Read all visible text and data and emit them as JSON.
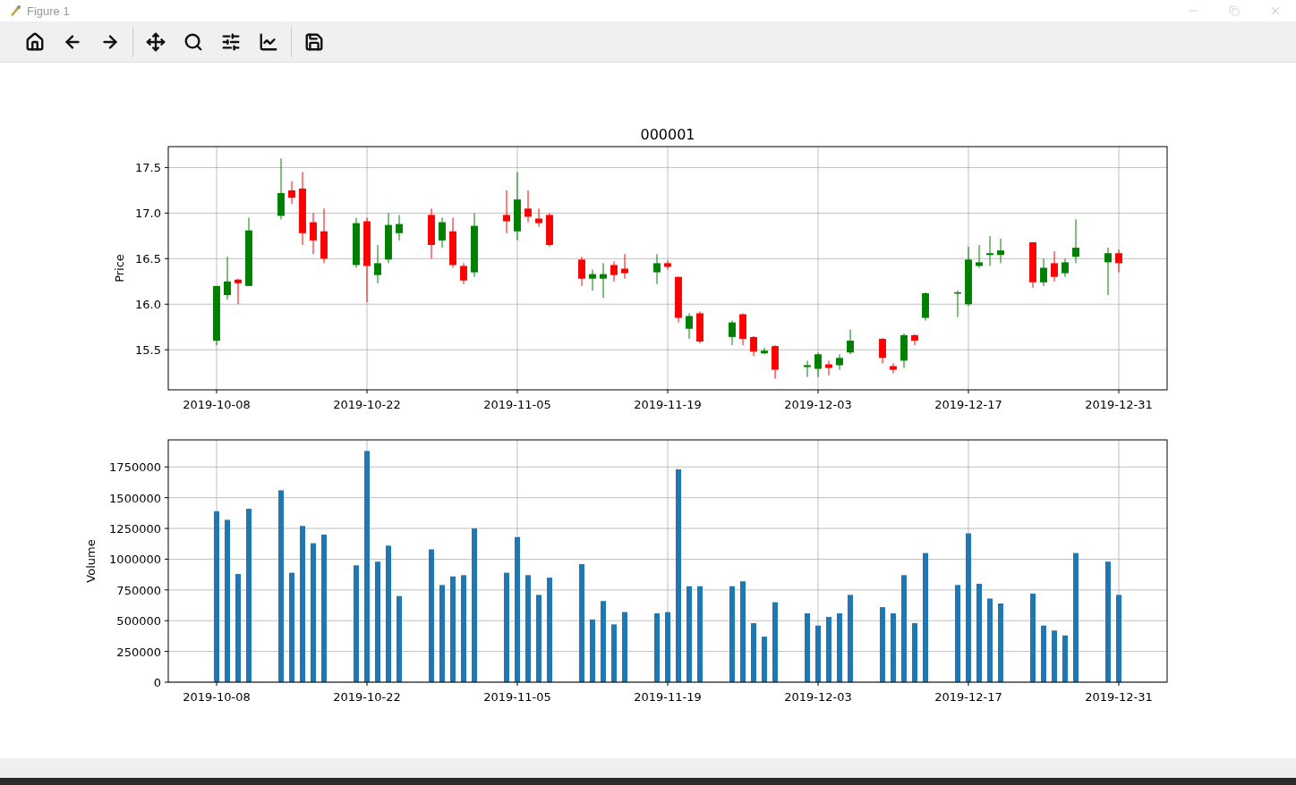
{
  "window": {
    "title": "Figure 1"
  },
  "toolbar": {
    "groups": [
      [
        {
          "kind": "home"
        },
        {
          "kind": "back"
        },
        {
          "kind": "forward"
        }
      ],
      [
        {
          "kind": "pan"
        },
        {
          "kind": "zoom"
        },
        {
          "kind": "configure"
        },
        {
          "kind": "edit-axes"
        }
      ],
      [
        {
          "kind": "save"
        }
      ]
    ]
  },
  "figure": {
    "charts": [
      {
        "chart_data": {
          "type": "candlestick",
          "title": "000001",
          "ylabel": "Price",
          "grid": true,
          "x": [
            "2019-10-08",
            "2019-10-09",
            "2019-10-10",
            "2019-10-11",
            "2019-10-14",
            "2019-10-15",
            "2019-10-16",
            "2019-10-17",
            "2019-10-18",
            "2019-10-21",
            "2019-10-22",
            "2019-10-23",
            "2019-10-24",
            "2019-10-25",
            "2019-10-28",
            "2019-10-29",
            "2019-10-30",
            "2019-10-31",
            "2019-11-01",
            "2019-11-04",
            "2019-11-05",
            "2019-11-06",
            "2019-11-07",
            "2019-11-08",
            "2019-11-11",
            "2019-11-12",
            "2019-11-13",
            "2019-11-14",
            "2019-11-15",
            "2019-11-18",
            "2019-11-19",
            "2019-11-20",
            "2019-11-21",
            "2019-11-22",
            "2019-11-25",
            "2019-11-26",
            "2019-11-27",
            "2019-11-28",
            "2019-11-29",
            "2019-12-02",
            "2019-12-03",
            "2019-12-04",
            "2019-12-05",
            "2019-12-06",
            "2019-12-09",
            "2019-12-10",
            "2019-12-11",
            "2019-12-12",
            "2019-12-13",
            "2019-12-16",
            "2019-12-17",
            "2019-12-18",
            "2019-12-19",
            "2019-12-20",
            "2019-12-23",
            "2019-12-24",
            "2019-12-25",
            "2019-12-26",
            "2019-12-27",
            "2019-12-30",
            "2019-12-31"
          ],
          "ohlc": [
            [
              15.6,
              16.2,
              15.55,
              16.2
            ],
            [
              16.1,
              16.52,
              16.05,
              16.25
            ],
            [
              16.27,
              16.28,
              16.0,
              16.23
            ],
            [
              16.2,
              16.95,
              16.2,
              16.81
            ],
            [
              16.97,
              17.6,
              16.93,
              17.22
            ],
            [
              17.25,
              17.35,
              17.1,
              17.17
            ],
            [
              17.27,
              17.45,
              16.65,
              16.78
            ],
            [
              16.9,
              17.0,
              16.55,
              16.7
            ],
            [
              16.8,
              17.05,
              16.45,
              16.5
            ],
            [
              16.43,
              16.95,
              16.4,
              16.89
            ],
            [
              16.91,
              16.95,
              16.02,
              16.42
            ],
            [
              16.32,
              16.65,
              16.23,
              16.45
            ],
            [
              16.49,
              17.0,
              16.45,
              16.87
            ],
            [
              16.78,
              16.98,
              16.7,
              16.88
            ],
            [
              16.98,
              17.05,
              16.5,
              16.65
            ],
            [
              16.7,
              16.95,
              16.62,
              16.9
            ],
            [
              16.8,
              16.95,
              16.4,
              16.43
            ],
            [
              16.42,
              16.45,
              16.22,
              16.26
            ],
            [
              16.35,
              17.0,
              16.3,
              16.86
            ],
            [
              16.98,
              17.25,
              16.78,
              16.91
            ],
            [
              16.8,
              17.45,
              16.7,
              17.15
            ],
            [
              17.05,
              17.25,
              16.9,
              16.96
            ],
            [
              16.94,
              17.05,
              16.85,
              16.89
            ],
            [
              16.98,
              17.0,
              16.63,
              16.65
            ],
            [
              16.49,
              16.52,
              16.2,
              16.28
            ],
            [
              16.28,
              16.38,
              16.15,
              16.33
            ],
            [
              16.28,
              16.45,
              16.07,
              16.33
            ],
            [
              16.43,
              16.47,
              16.25,
              16.32
            ],
            [
              16.39,
              16.55,
              16.28,
              16.34
            ],
            [
              16.35,
              16.55,
              16.22,
              16.45
            ],
            [
              16.45,
              16.48,
              16.38,
              16.41
            ],
            [
              16.3,
              16.3,
              15.8,
              15.85
            ],
            [
              15.73,
              15.9,
              15.62,
              15.87
            ],
            [
              15.9,
              15.92,
              15.57,
              15.59
            ],
            [
              15.64,
              15.82,
              15.55,
              15.8
            ],
            [
              15.89,
              15.9,
              15.55,
              15.62
            ],
            [
              15.64,
              15.65,
              15.43,
              15.48
            ],
            [
              15.46,
              15.52,
              15.45,
              15.49
            ],
            [
              15.54,
              15.55,
              15.18,
              15.28
            ],
            [
              15.31,
              15.38,
              15.2,
              15.33
            ],
            [
              15.29,
              15.47,
              15.2,
              15.45
            ],
            [
              15.34,
              15.38,
              15.22,
              15.3
            ],
            [
              15.33,
              15.45,
              15.28,
              15.41
            ],
            [
              15.47,
              15.72,
              15.45,
              15.6
            ],
            [
              15.62,
              15.63,
              15.35,
              15.41
            ],
            [
              15.32,
              15.35,
              15.24,
              15.28
            ],
            [
              15.38,
              15.68,
              15.3,
              15.66
            ],
            [
              15.66,
              15.67,
              15.55,
              15.6
            ],
            [
              15.85,
              16.13,
              15.82,
              16.12
            ],
            [
              16.12,
              16.15,
              15.86,
              16.13
            ],
            [
              16.0,
              16.63,
              15.98,
              16.49
            ],
            [
              16.42,
              16.65,
              16.4,
              16.46
            ],
            [
              16.54,
              16.75,
              16.42,
              16.56
            ],
            [
              16.54,
              16.72,
              16.45,
              16.59
            ],
            [
              16.68,
              16.68,
              16.18,
              16.24
            ],
            [
              16.24,
              16.5,
              16.2,
              16.4
            ],
            [
              16.45,
              16.58,
              16.25,
              16.3
            ],
            [
              16.34,
              16.5,
              16.3,
              16.46
            ],
            [
              16.52,
              16.93,
              16.45,
              16.62
            ],
            [
              16.46,
              16.62,
              16.1,
              16.56
            ],
            [
              16.56,
              16.6,
              16.35,
              16.45
            ]
          ],
          "xlim": [
            "2019-10-03T12:00Z",
            "2020-01-04T12:00Z"
          ],
          "ylim": [
            15.06,
            17.73
          ],
          "xticks": [
            {
              "value": "2019-10-08",
              "label": "2019-10-08"
            },
            {
              "value": "2019-10-22",
              "label": "2019-10-22"
            },
            {
              "value": "2019-11-05",
              "label": "2019-11-05"
            },
            {
              "value": "2019-11-19",
              "label": "2019-11-19"
            },
            {
              "value": "2019-12-03",
              "label": "2019-12-03"
            },
            {
              "value": "2019-12-17",
              "label": "2019-12-17"
            },
            {
              "value": "2019-12-31",
              "label": "2019-12-31"
            }
          ],
          "yticks": [
            {
              "value": 15.5,
              "label": "15.5"
            },
            {
              "value": 16,
              "label": "16.0"
            },
            {
              "value": 16.5,
              "label": "16.5"
            },
            {
              "value": 17,
              "label": "17.0"
            },
            {
              "value": 17.5,
              "label": "17.5"
            }
          ]
        }
      },
      {
        "chart_data": {
          "type": "bar",
          "ylabel": "Volume",
          "grid": true,
          "x": [
            "2019-10-08",
            "2019-10-09",
            "2019-10-10",
            "2019-10-11",
            "2019-10-14",
            "2019-10-15",
            "2019-10-16",
            "2019-10-17",
            "2019-10-18",
            "2019-10-21",
            "2019-10-22",
            "2019-10-23",
            "2019-10-24",
            "2019-10-25",
            "2019-10-28",
            "2019-10-29",
            "2019-10-30",
            "2019-10-31",
            "2019-11-01",
            "2019-11-04",
            "2019-11-05",
            "2019-11-06",
            "2019-11-07",
            "2019-11-08",
            "2019-11-11",
            "2019-11-12",
            "2019-11-13",
            "2019-11-14",
            "2019-11-15",
            "2019-11-18",
            "2019-11-19",
            "2019-11-20",
            "2019-11-21",
            "2019-11-22",
            "2019-11-25",
            "2019-11-26",
            "2019-11-27",
            "2019-11-28",
            "2019-11-29",
            "2019-12-02",
            "2019-12-03",
            "2019-12-04",
            "2019-12-05",
            "2019-12-06",
            "2019-12-09",
            "2019-12-10",
            "2019-12-11",
            "2019-12-12",
            "2019-12-13",
            "2019-12-16",
            "2019-12-17",
            "2019-12-18",
            "2019-12-19",
            "2019-12-20",
            "2019-12-23",
            "2019-12-24",
            "2019-12-25",
            "2019-12-26",
            "2019-12-27",
            "2019-12-30",
            "2019-12-31"
          ],
          "values": [
            1390000,
            1320000,
            880000,
            1410000,
            1560000,
            890000,
            1270000,
            1130000,
            1200000,
            950000,
            1880000,
            980000,
            1110000,
            700000,
            1080000,
            790000,
            860000,
            870000,
            1250000,
            890000,
            1180000,
            870000,
            710000,
            850000,
            960000,
            510000,
            660000,
            470000,
            570000,
            560000,
            570000,
            1730000,
            780000,
            780000,
            780000,
            820000,
            480000,
            370000,
            650000,
            560000,
            460000,
            530000,
            560000,
            710000,
            610000,
            560000,
            870000,
            480000,
            1050000,
            790000,
            1210000,
            800000,
            680000,
            640000,
            720000,
            460000,
            420000,
            380000,
            1050000,
            980000,
            710000
          ],
          "xlim": [
            "2019-10-03T12:00Z",
            "2020-01-04T12:00Z"
          ],
          "ylim": [
            0,
            1970000
          ],
          "xticks": [
            {
              "value": "2019-10-08",
              "label": "2019-10-08"
            },
            {
              "value": "2019-10-22",
              "label": "2019-10-22"
            },
            {
              "value": "2019-11-05",
              "label": "2019-11-05"
            },
            {
              "value": "2019-11-19",
              "label": "2019-11-19"
            },
            {
              "value": "2019-12-03",
              "label": "2019-12-03"
            },
            {
              "value": "2019-12-17",
              "label": "2019-12-17"
            },
            {
              "value": "2019-12-31",
              "label": "2019-12-31"
            }
          ],
          "yticks": [
            {
              "value": 0,
              "label": "0"
            },
            {
              "value": 250000,
              "label": "250000"
            },
            {
              "value": 500000,
              "label": "500000"
            },
            {
              "value": 750000,
              "label": "750000"
            },
            {
              "value": 1000000,
              "label": "1000000"
            },
            {
              "value": 1250000,
              "label": "1250000"
            },
            {
              "value": 1500000,
              "label": "1500000"
            },
            {
              "value": 1750000,
              "label": "1750000"
            }
          ]
        }
      }
    ]
  }
}
